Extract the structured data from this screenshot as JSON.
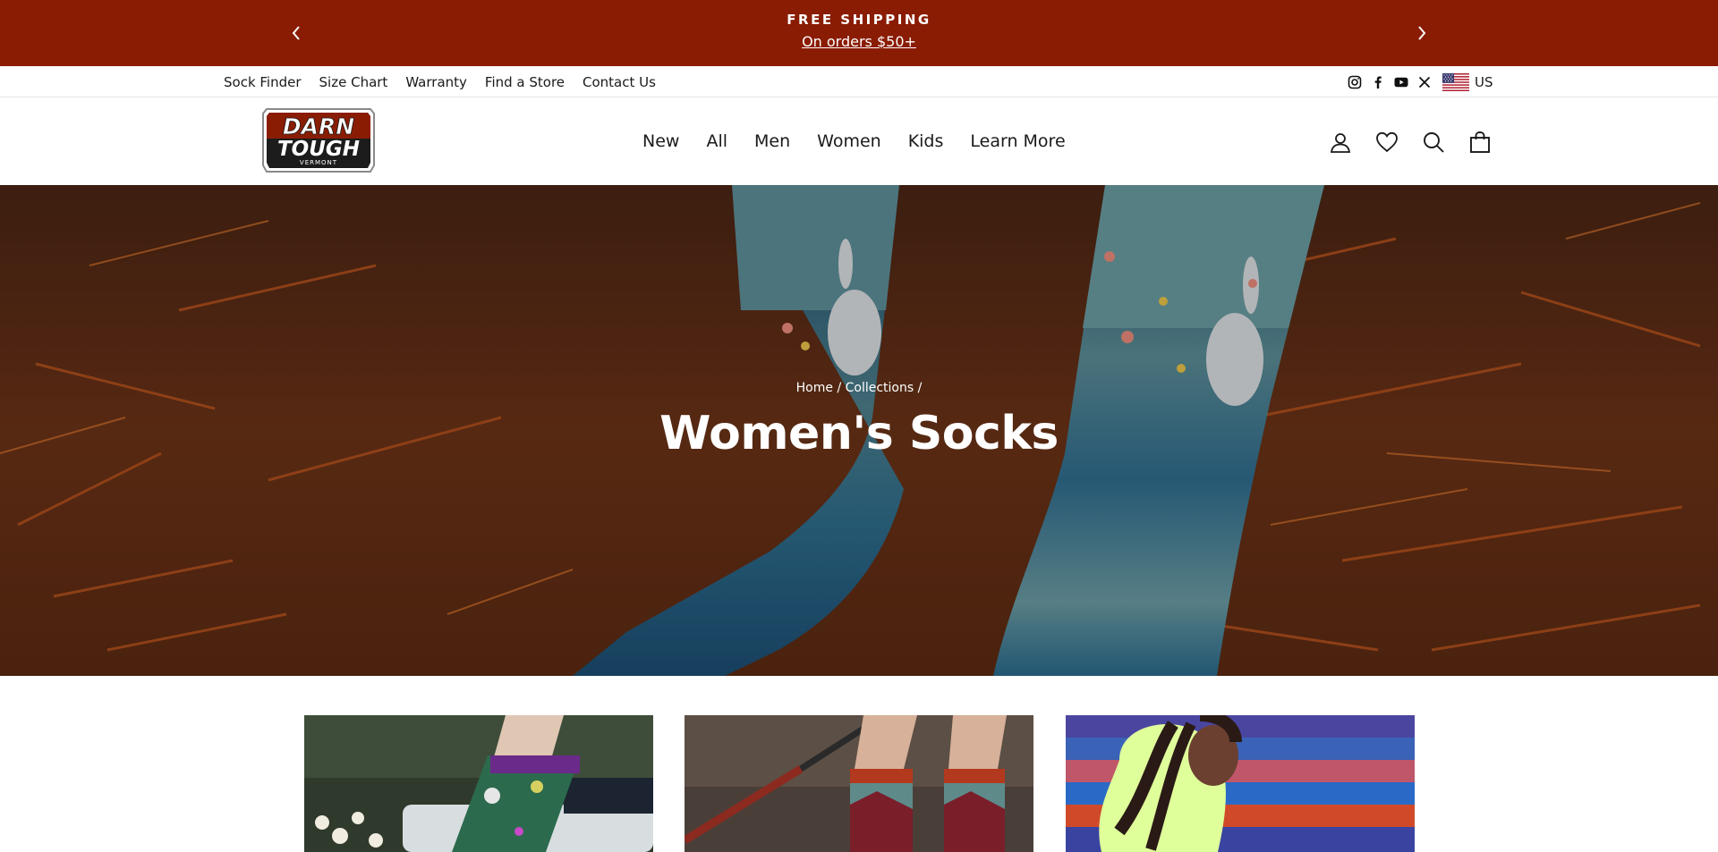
{
  "announcement": {
    "title": "FREE SHIPPING",
    "subtitle": "On orders $50+",
    "prev_icon": "chevron-left-icon",
    "next_icon": "chevron-right-icon",
    "background_color": "#8a1c04"
  },
  "utility_nav": {
    "links": [
      "Sock Finder",
      "Size Chart",
      "Warranty",
      "Find a Store",
      "Contact Us"
    ],
    "social_icons": [
      "instagram-icon",
      "facebook-icon",
      "youtube-icon",
      "x-icon"
    ],
    "locale": {
      "flag_icon": "us-flag-icon",
      "label": "US"
    }
  },
  "header": {
    "logo": {
      "line1": "DARN",
      "line2": "TOUGH",
      "line3": "VERMONT"
    },
    "nav": [
      "New",
      "All",
      "Men",
      "Women",
      "Kids",
      "Learn More"
    ],
    "icons": [
      "account-icon",
      "wishlist-heart-icon",
      "search-icon",
      "cart-bag-icon"
    ]
  },
  "hero": {
    "breadcrumb": {
      "home": "Home",
      "separator": "/",
      "collections": "Collections"
    },
    "title": "Women's Socks"
  },
  "products": [
    {
      "image": "product-image-1"
    },
    {
      "image": "product-image-2"
    },
    {
      "image": "product-image-3"
    }
  ]
}
